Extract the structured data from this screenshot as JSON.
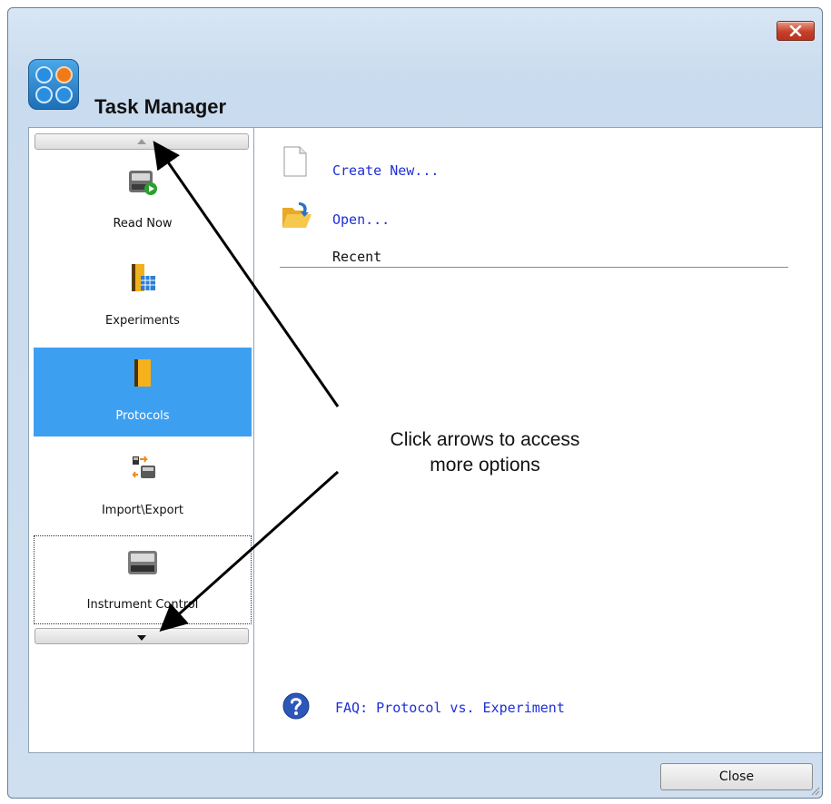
{
  "window": {
    "title": "Task Manager",
    "close_icon": "close-x-icon",
    "logo_icon": "four-circles-logo-icon",
    "close_button_color": "#c7402b"
  },
  "sidebar": {
    "scroll_up_icon": "chevron-up-icon",
    "scroll_down_icon": "chevron-down-icon",
    "items": [
      {
        "label": "Read Now",
        "icon": "reader-play-icon",
        "selected": false
      },
      {
        "label": "Experiments",
        "icon": "book-grid-icon",
        "selected": false
      },
      {
        "label": "Protocols",
        "icon": "book-icon",
        "selected": true
      },
      {
        "label": "Import\\Export",
        "icon": "import-export-icon",
        "selected": false
      },
      {
        "label": "Instrument Control",
        "icon": "instrument-icon",
        "selected": false
      }
    ],
    "selected_color": "#3d9ff0"
  },
  "main": {
    "create_new": "Create New...",
    "open": "Open...",
    "recent_header": "Recent",
    "faq_link": "FAQ: Protocol vs. Experiment",
    "link_color": "#1f2fd6"
  },
  "annotation": {
    "text_line1": "Click arrows to access",
    "text_line2": "more options"
  },
  "footer": {
    "close_label": "Close"
  }
}
